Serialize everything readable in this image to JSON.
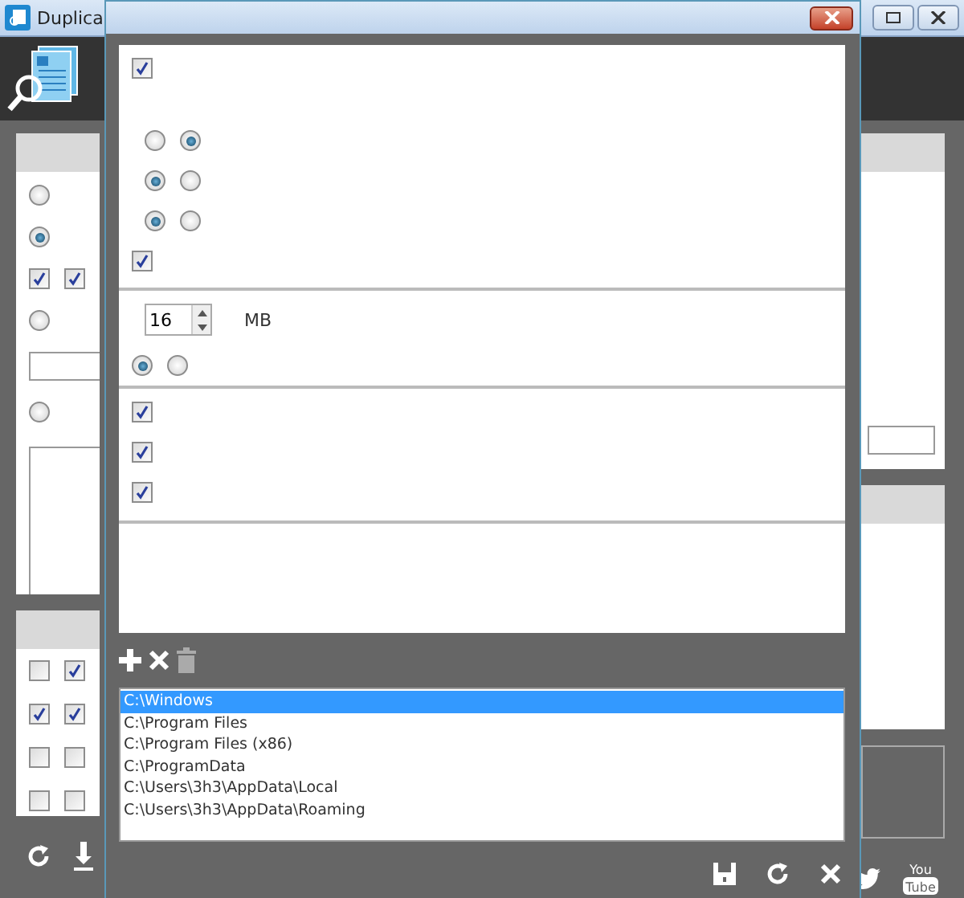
{
  "main_window": {
    "title": "Duplica",
    "left_panel": [
      {
        "kind": "radio",
        "selected": false
      },
      {
        "kind": "radio",
        "selected": true
      },
      {
        "kind": "checkboxes",
        "items": [
          {
            "checked": true
          },
          {
            "checked": true
          }
        ]
      },
      {
        "kind": "radio",
        "selected": false
      },
      {
        "kind": "input"
      },
      {
        "kind": "radio",
        "selected": false
      },
      {
        "kind": "textarea"
      }
    ],
    "filter_rows": [
      [
        {
          "checked": false
        },
        {
          "checked": true
        }
      ],
      [
        {
          "checked": true
        },
        {
          "checked": true
        }
      ],
      [
        {
          "checked": false
        },
        {
          "checked": false
        }
      ],
      [
        {
          "checked": false
        },
        {
          "checked": false
        }
      ]
    ],
    "youtube_logo": {
      "top": "You",
      "bottom": "Tube"
    }
  },
  "dialog": {
    "sections": [
      {
        "rows": [
          {
            "kind": "checkbox",
            "checked": true
          },
          {
            "kind": "gap"
          },
          {
            "kind": "radios",
            "options": [
              {
                "selected": false
              },
              {
                "selected": true
              }
            ]
          },
          {
            "kind": "radios",
            "options": [
              {
                "selected": true
              },
              {
                "selected": false
              }
            ]
          },
          {
            "kind": "radios",
            "options": [
              {
                "selected": true
              },
              {
                "selected": false
              }
            ]
          },
          {
            "kind": "checkbox",
            "checked": true
          }
        ]
      },
      {
        "rows": [
          {
            "kind": "size",
            "value": "16",
            "unit": "MB"
          },
          {
            "kind": "radios",
            "options": [
              {
                "selected": true
              },
              {
                "selected": false
              }
            ]
          }
        ]
      },
      {
        "rows": [
          {
            "kind": "checkbox",
            "checked": true
          },
          {
            "kind": "checkbox",
            "checked": true
          },
          {
            "kind": "checkbox",
            "checked": true
          }
        ]
      }
    ],
    "folders": [
      {
        "path": "C:\\Windows",
        "selected": true
      },
      {
        "path": "C:\\Program Files",
        "selected": false
      },
      {
        "path": "C:\\Program Files (x86)",
        "selected": false
      },
      {
        "path": "C:\\ProgramData",
        "selected": false
      },
      {
        "path": "C:\\Users\\3h3\\AppData\\Local",
        "selected": false
      },
      {
        "path": "C:\\Users\\3h3\\AppData\\Roaming",
        "selected": false
      }
    ]
  }
}
